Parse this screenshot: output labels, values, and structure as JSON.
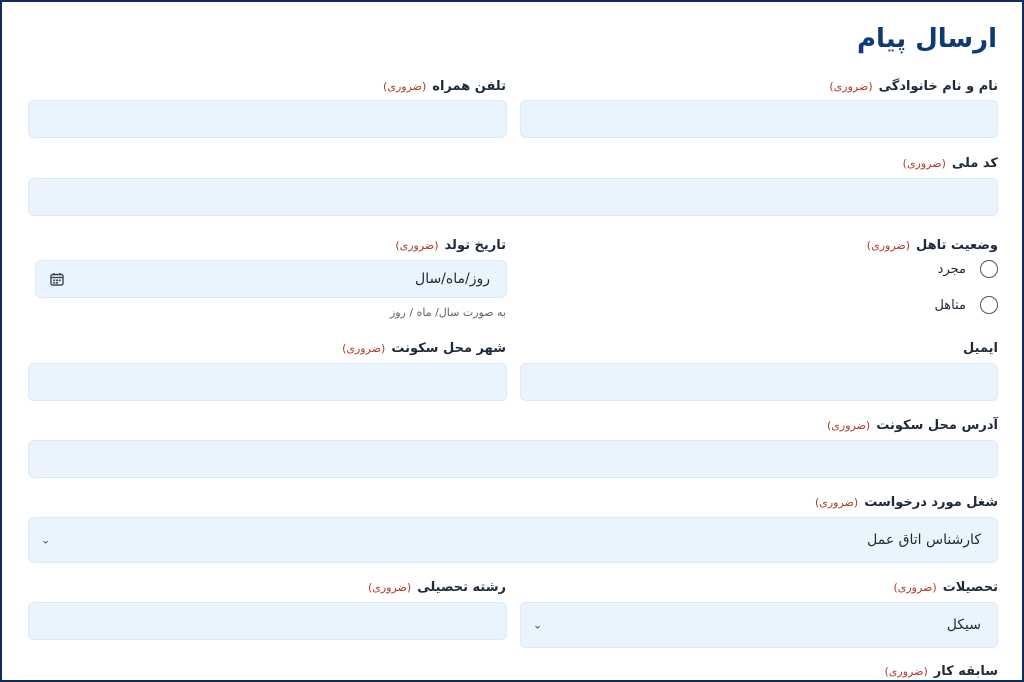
{
  "form": {
    "title": "ارسال پیام",
    "required_tag": "(ضروری)",
    "full_name_label": "نام و نام خانوادگی",
    "mobile_label": "تلفن همراه",
    "national_code_label": "کد ملی",
    "marital_label": "وضعیت تاهل",
    "marital_options": [
      "مجرد",
      "متاهل"
    ],
    "birth_label": "تاریخ تولد",
    "birth_placeholder": "روز/ماه/سال",
    "birth_hint": "به صورت سال/ ماه / روز",
    "email_label": "ایمیل",
    "city_label": "شهر محل سکونت",
    "address_label": "آدرس محل سکونت",
    "job_label": "شغل مورد درخواست",
    "job_value": "کارشناس اتاق عمل",
    "education_label": "تحصیلات",
    "education_value": "سیکل",
    "field_of_study_label": "رشته تحصیلی",
    "experience_label": "سابقه کار"
  },
  "colors": {
    "title": "#0f3a78",
    "required": "#b0392b",
    "field_bg": "#eaf4ff"
  }
}
